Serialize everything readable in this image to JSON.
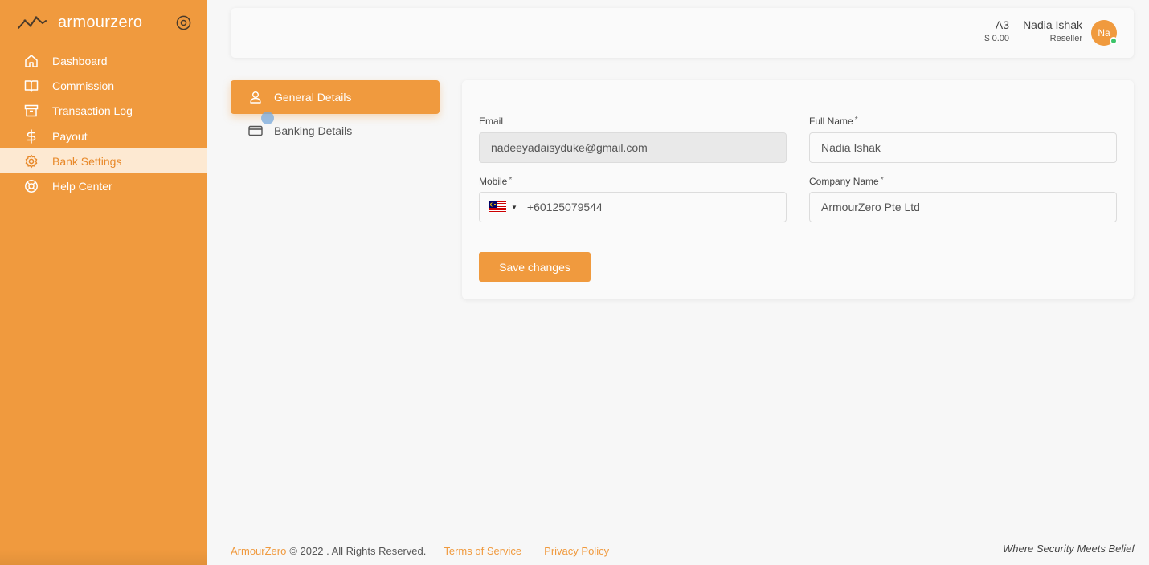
{
  "brand": {
    "name": "armourzero"
  },
  "sidebar": {
    "items": [
      {
        "label": "Dashboard",
        "icon": "home-icon",
        "active": false
      },
      {
        "label": "Commission",
        "icon": "book-icon",
        "active": false
      },
      {
        "label": "Transaction Log",
        "icon": "archive-icon",
        "active": false
      },
      {
        "label": "Payout",
        "icon": "dollar-icon",
        "active": false
      },
      {
        "label": "Bank Settings",
        "icon": "gear-icon",
        "active": true
      },
      {
        "label": "Help Center",
        "icon": "lifebuoy-icon",
        "active": false
      }
    ]
  },
  "header": {
    "wallet_code": "A3",
    "wallet_balance": "$ 0.00",
    "user_name": "Nadia Ishak",
    "user_role": "Reseller",
    "avatar_initials": "Na"
  },
  "tabs": {
    "general": "General Details",
    "banking": "Banking Details"
  },
  "form": {
    "email_label": "Email",
    "email_value": "nadeeyadaisyduke@gmail.com",
    "fullname_label": "Full Name",
    "fullname_value": "Nadia Ishak",
    "mobile_label": "Mobile",
    "mobile_value": "+60125079544",
    "company_label": "Company Name",
    "company_value": "ArmourZero Pte Ltd",
    "required_mark": "*",
    "save_label": "Save changes"
  },
  "footer": {
    "brand": "ArmourZero",
    "copyright": "© 2022 . All Rights Reserved.",
    "terms": "Terms of Service",
    "privacy": "Privacy Policy",
    "tagline": "Where Security Meets Belief"
  },
  "colors": {
    "accent": "#f09a3e",
    "active_nav_bg": "#fde9d2",
    "online": "#3cc46a"
  }
}
